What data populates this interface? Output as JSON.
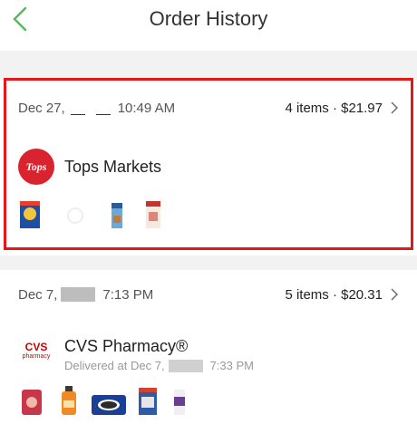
{
  "header": {
    "title": "Order History"
  },
  "orders": [
    {
      "date_prefix": "Dec 27,",
      "time": "10:49 AM",
      "summary": "4 items · $21.97",
      "store_name": "Tops Markets",
      "logo_text": "Tops"
    },
    {
      "date_prefix": "Dec 7,",
      "time": "7:13 PM",
      "summary": "5 items · $20.31",
      "store_name": "CVS Pharmacy®",
      "delivered_prefix": "Delivered at Dec 7,",
      "delivered_time": "7:33 PM",
      "logo_text": "CVS",
      "logo_subtext": "pharmacy"
    }
  ],
  "colors": {
    "accent_green": "#5cb85c",
    "highlight_red": "#e4171b",
    "tops_red": "#d9232e",
    "cvs_red": "#cc0000"
  }
}
